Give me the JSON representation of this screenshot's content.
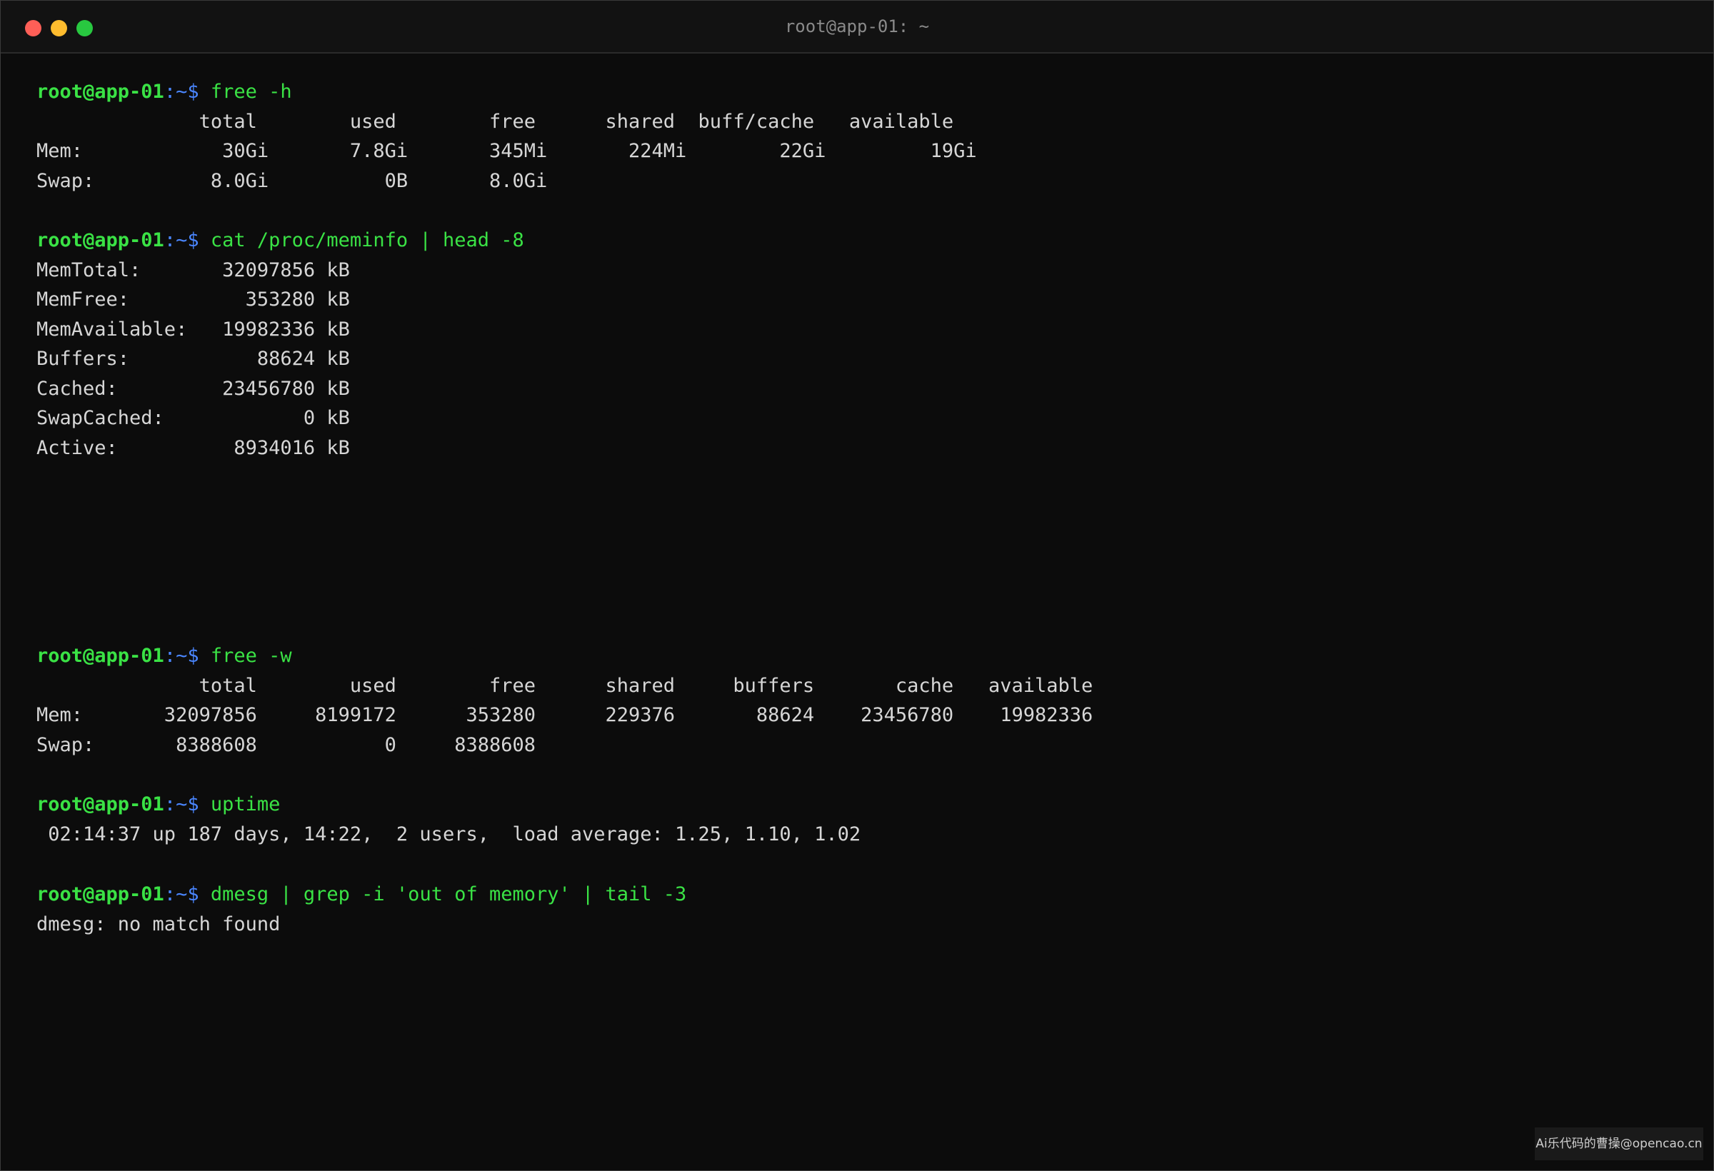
{
  "window": {
    "title": "root@app-01: ~"
  },
  "prompt": {
    "user_host": "root@app-01",
    "path": ":~",
    "symbol": "$ "
  },
  "blocks": [
    {
      "command": "free -h",
      "output": [
        "              total        used        free      shared  buff/cache   available",
        "Mem:            30Gi       7.8Gi       345Mi       224Mi        22Gi         19Gi",
        "Swap:          8.0Gi          0B       8.0Gi"
      ]
    },
    {
      "command": "cat /proc/meminfo | head -8",
      "output": [
        "MemTotal:       32097856 kB",
        "MemFree:          353280 kB",
        "MemAvailable:   19982336 kB",
        "Buffers:           88624 kB",
        "Cached:         23456780 kB",
        "SwapCached:            0 kB",
        "Active:          8934016 kB"
      ]
    },
    {
      "command": "free -w",
      "output": [
        "              total        used        free      shared     buffers       cache   available",
        "Mem:       32097856     8199172      353280      229376       88624    23456780    19982336",
        "Swap:       8388608           0     8388608"
      ]
    },
    {
      "command": "uptime",
      "output": [
        " 02:14:37 up 187 days, 14:22,  2 users,  load average: 1.25, 1.10, 1.02"
      ]
    },
    {
      "command": "dmesg | grep -i 'out of memory' | tail -3",
      "output": [
        "dmesg: no match found"
      ]
    }
  ],
  "watermark": "Ai乐代码的曹操@opencao.cn"
}
